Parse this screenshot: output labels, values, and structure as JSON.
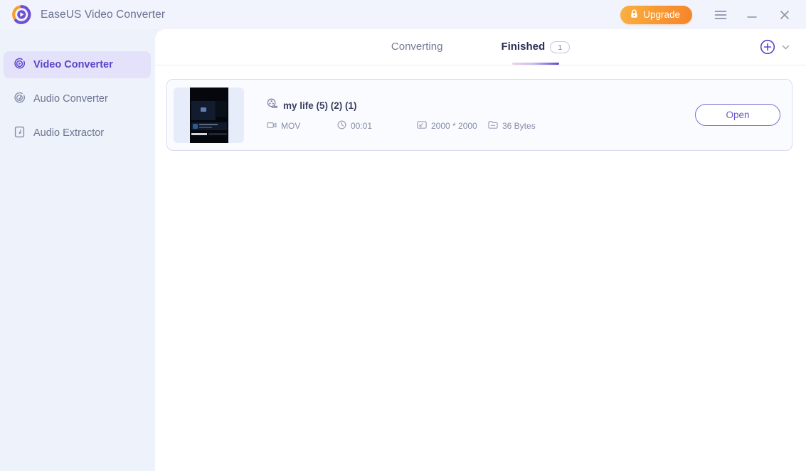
{
  "window": {
    "app_title": "EaseUS Video Converter",
    "logo_icon": "easeus-circular-play-logo",
    "upgrade_label": "Upgrade",
    "upgrade_icon": "lock-icon",
    "menu_icon": "hamburger-menu-icon",
    "minimize_icon": "minimize-icon",
    "close_icon": "close-icon",
    "accent_purple": "#5b44c9",
    "accent_orange": "#f6852b"
  },
  "sidebar": {
    "items": [
      {
        "label": "Video Converter",
        "icon": "video-converter-icon",
        "active": true
      },
      {
        "label": "Audio Converter",
        "icon": "audio-converter-icon",
        "active": false
      },
      {
        "label": "Audio Extractor",
        "icon": "audio-extractor-icon",
        "active": false
      }
    ]
  },
  "main": {
    "tabs": [
      {
        "label": "Converting",
        "badge": "",
        "active": false
      },
      {
        "label": "Finished",
        "badge": "1",
        "active": true
      }
    ],
    "add_icon": "add-circle-icon",
    "chevron_icon": "chevron-down-icon",
    "files": [
      {
        "name": "my life (5) (2) (1)",
        "name_icon": "film-reel-icon",
        "format": "MOV",
        "format_icon": "video-camera-icon",
        "duration": "00:01",
        "duration_icon": "clock-icon",
        "resolution": "2000 * 2000",
        "resolution_icon": "resolution-icon",
        "size": "36 Bytes",
        "size_icon": "file-size-icon",
        "action_label": "Open",
        "thumbnail": "dark-video-frame-thumbnail"
      }
    ]
  }
}
